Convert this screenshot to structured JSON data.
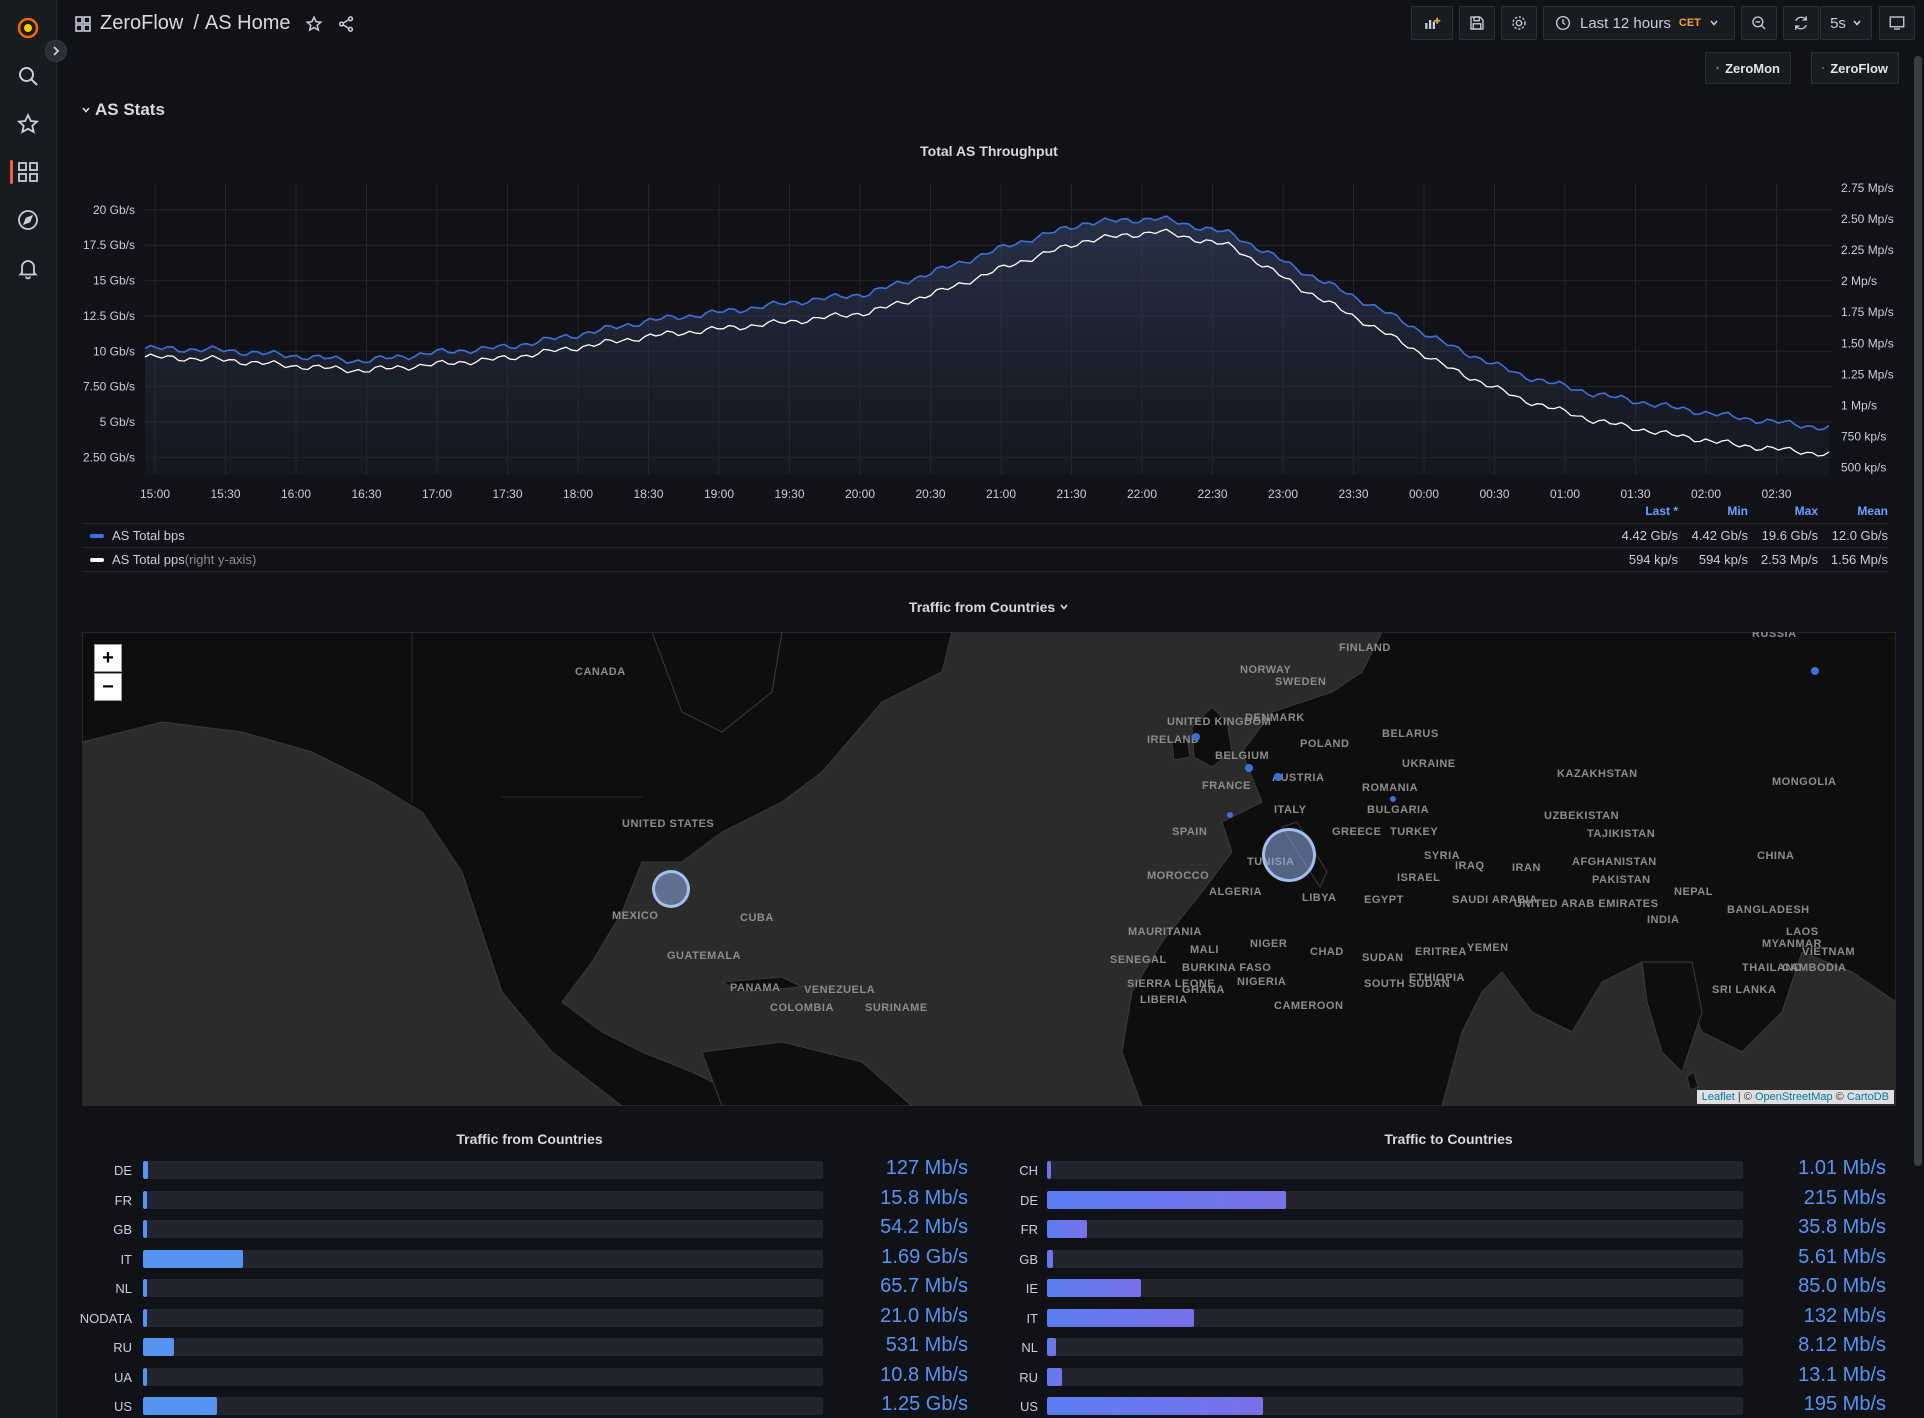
{
  "header": {
    "folder": "ZeroFlow",
    "separator": "/",
    "title": "AS Home",
    "time_range": "Last 12 hours",
    "timezone": "CET",
    "refresh": "5s"
  },
  "links": [
    {
      "label": "ZeroMon"
    },
    {
      "label": "ZeroFlow"
    }
  ],
  "row": {
    "title": "AS Stats"
  },
  "throughput": {
    "title": "Total AS Throughput",
    "legend_headers": {
      "last": "Last *",
      "min": "Min",
      "max": "Max",
      "mean": "Mean"
    },
    "series": [
      {
        "name": "AS Total bps",
        "suffix": "",
        "last": "4.42 Gb/s",
        "min": "4.42 Gb/s",
        "max": "19.6 Gb/s",
        "mean": "12.0 Gb/s",
        "color": "#3d71d9"
      },
      {
        "name": "AS Total pps",
        "suffix": " (right y-axis)",
        "last": "594 kp/s",
        "min": "594 kp/s",
        "max": "2.53 Mp/s",
        "mean": "1.56 Mp/s",
        "color": "#ffffff"
      }
    ]
  },
  "chart_data": {
    "type": "line",
    "title": "Total AS Throughput",
    "x": [
      "15:00",
      "15:30",
      "16:00",
      "16:30",
      "17:00",
      "17:30",
      "18:00",
      "18:30",
      "19:00",
      "19:30",
      "20:00",
      "20:30",
      "21:00",
      "21:30",
      "22:00",
      "22:30",
      "23:00",
      "23:30",
      "00:00",
      "00:30",
      "01:00",
      "01:30",
      "02:00",
      "02:30"
    ],
    "y_left_ticks": [
      "2.50 Gb/s",
      "5 Gb/s",
      "7.50 Gb/s",
      "10 Gb/s",
      "12.5 Gb/s",
      "15 Gb/s",
      "17.5 Gb/s",
      "20 Gb/s"
    ],
    "y_right_ticks": [
      "500 kp/s",
      "750 kp/s",
      "1 Mp/s",
      "1.25 Mp/s",
      "1.50 Mp/s",
      "1.75 Mp/s",
      "2 Mp/s",
      "2.25 Mp/s",
      "2.50 Mp/s",
      "2.75 Mp/s"
    ],
    "ylim_left": [
      2.5,
      20
    ],
    "ylim_right": [
      0.5,
      2.75
    ],
    "series": [
      {
        "name": "AS Total bps",
        "axis": "left",
        "unit": "Gb/s",
        "values": [
          10.2,
          10.1,
          9.7,
          9.3,
          9.9,
          10.3,
          11.2,
          12.2,
          12.8,
          13.5,
          14.1,
          15.8,
          17.6,
          19.1,
          19.4,
          18.3,
          15.6,
          13.1,
          10.4,
          8.3,
          7.0,
          6.1,
          5.3,
          4.7
        ]
      },
      {
        "name": "AS Total pps",
        "axis": "right",
        "unit": "Mp/s",
        "values": [
          1.39,
          1.37,
          1.32,
          1.28,
          1.33,
          1.38,
          1.47,
          1.56,
          1.62,
          1.68,
          1.75,
          1.92,
          2.14,
          2.33,
          2.4,
          2.28,
          1.93,
          1.62,
          1.3,
          1.05,
          0.88,
          0.77,
          0.68,
          0.62
        ]
      }
    ]
  },
  "map": {
    "title": "Traffic from Countries",
    "zoom_in": "+",
    "zoom_out": "−",
    "attribution_leaflet": "Leaflet",
    "attribution_sep": " | © ",
    "attribution_osm": "OpenStreetMap",
    "attribution_mid": " © ",
    "attribution_carto": "CartoDB",
    "labels": [
      "CANADA",
      "UNITED STATES",
      "MEXICO",
      "CUBA",
      "GUATEMALA",
      "PANAMA",
      "VENEZUELA",
      "COLOMBIA",
      "SURINAME",
      "FINLAND",
      "NORWAY",
      "SWEDEN",
      "DENMARK",
      "UNITED KINGDOM",
      "IRELAND",
      "BELGIUM",
      "POLAND",
      "BELARUS",
      "UKRAINE",
      "FRANCE",
      "AUSTRIA",
      "ROMANIA",
      "ITALY",
      "BULGARIA",
      "SPAIN",
      "GREECE",
      "TURKEY",
      "TUNISIA",
      "SYRIA",
      "IRAQ",
      "IRAN",
      "ISRAEL",
      "MOROCCO",
      "ALGERIA",
      "LIBYA",
      "EGYPT",
      "SAUDI ARABIA",
      "UNITED ARAB EMIRATES",
      "MAURITANIA",
      "MALI",
      "NIGER",
      "CHAD",
      "SUDAN",
      "ERITREA",
      "YEMEN",
      "SENEGAL",
      "BURKINA FASO",
      "NIGERIA",
      "GHANA",
      "SIERRA LEONE",
      "LIBERIA",
      "CAMEROON",
      "SOUTH SUDAN",
      "ETHIOPIA",
      "KAZAKHSTAN",
      "UZBEKISTAN",
      "TAJIKISTAN",
      "AFGHANISTAN",
      "PAKISTAN",
      "INDIA",
      "NEPAL",
      "BANGLADESH",
      "CHINA",
      "MONGOLIA",
      "RUSSIA",
      "MYANMAR",
      "LAOS",
      "VIETNAM",
      "CAMBODIA",
      "SRI LANKA",
      "THAILAND"
    ]
  },
  "traffic_from": {
    "title": "Traffic from Countries",
    "rows": [
      {
        "code": "DE",
        "value": "127 Mb/s",
        "level": 0.0075
      },
      {
        "code": "FR",
        "value": "15.8 Mb/s",
        "level": 0.001
      },
      {
        "code": "GB",
        "value": "54.2 Mb/s",
        "level": 0.003
      },
      {
        "code": "IT",
        "value": "1.69 Gb/s",
        "level": 0.147
      },
      {
        "code": "NL",
        "value": "65.7 Mb/s",
        "level": 0.004
      },
      {
        "code": "NODATA",
        "value": "21.0 Mb/s",
        "level": 0.001
      },
      {
        "code": "RU",
        "value": "531 Mb/s",
        "level": 0.046
      },
      {
        "code": "UA",
        "value": "10.8 Mb/s",
        "level": 0.001
      },
      {
        "code": "US",
        "value": "1.25 Gb/s",
        "level": 0.109
      }
    ]
  },
  "traffic_to": {
    "title": "Traffic to Countries",
    "rows": [
      {
        "code": "CH",
        "value": "1.01 Mb/s",
        "level": 0.001
      },
      {
        "code": "DE",
        "value": "215 Mb/s",
        "level": 0.343
      },
      {
        "code": "FR",
        "value": "35.8 Mb/s",
        "level": 0.057
      },
      {
        "code": "GB",
        "value": "5.61 Mb/s",
        "level": 0.009
      },
      {
        "code": "IE",
        "value": "85.0 Mb/s",
        "level": 0.135
      },
      {
        "code": "IT",
        "value": "132 Mb/s",
        "level": 0.211
      },
      {
        "code": "NL",
        "value": "8.12 Mb/s",
        "level": 0.013
      },
      {
        "code": "RU",
        "value": "13.1 Mb/s",
        "level": 0.021
      },
      {
        "code": "US",
        "value": "195 Mb/s",
        "level": 0.311
      }
    ]
  }
}
